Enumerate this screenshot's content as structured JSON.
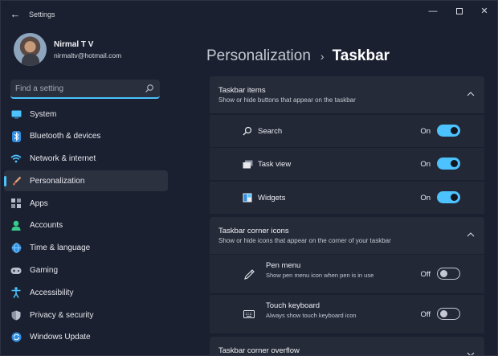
{
  "window": {
    "title": "Settings"
  },
  "user": {
    "name": "Nirmal T V",
    "email": "nirmaltv@hotmail.com"
  },
  "search": {
    "placeholder": "Find a setting"
  },
  "nav": {
    "items": [
      {
        "label": "System",
        "icon": "monitor-icon",
        "color": "#4cc2ff"
      },
      {
        "label": "Bluetooth & devices",
        "icon": "bluetooth-icon",
        "color": "#4cc2ff"
      },
      {
        "label": "Network & internet",
        "icon": "wifi-icon",
        "color": "#4cc2ff"
      },
      {
        "label": "Personalization",
        "icon": "brush-icon",
        "color": "#e8a87c"
      },
      {
        "label": "Apps",
        "icon": "apps-icon",
        "color": "#b9bfcc"
      },
      {
        "label": "Accounts",
        "icon": "person-icon",
        "color": "#38c98c"
      },
      {
        "label": "Time & language",
        "icon": "globe-clock-icon",
        "color": "#4cc2ff"
      },
      {
        "label": "Gaming",
        "icon": "gamepad-icon",
        "color": "#b9bfcc"
      },
      {
        "label": "Accessibility",
        "icon": "accessibility-icon",
        "color": "#4cc2ff"
      },
      {
        "label": "Privacy & security",
        "icon": "shield-icon",
        "color": "#b9bfcc"
      },
      {
        "label": "Windows Update",
        "icon": "update-icon",
        "color": "#4cc2ff"
      }
    ],
    "active_index": 3
  },
  "breadcrumb": {
    "parent": "Personalization",
    "separator": "›",
    "current": "Taskbar"
  },
  "groups": {
    "taskbar_items": {
      "title": "Taskbar items",
      "subtitle": "Show or hide buttons that appear on the taskbar",
      "rows": [
        {
          "label": "Search",
          "state": "On",
          "icon": "search-icon"
        },
        {
          "label": "Task view",
          "state": "On",
          "icon": "task-view-icon"
        },
        {
          "label": "Widgets",
          "state": "On",
          "icon": "widgets-icon"
        }
      ]
    },
    "corner_icons": {
      "title": "Taskbar corner icons",
      "subtitle": "Show or hide icons that appear on the corner of your taskbar",
      "rows": [
        {
          "label": "Pen menu",
          "description": "Show pen menu icon when pen is in use",
          "state": "Off",
          "icon": "pen-icon"
        },
        {
          "label": "Touch keyboard",
          "description": "Always show touch keyboard icon",
          "state": "Off",
          "icon": "keyboard-icon"
        }
      ]
    },
    "corner_overflow": {
      "title": "Taskbar corner overflow"
    }
  },
  "colors": {
    "accent": "#4cc2ff",
    "background": "#1b2030",
    "card": "#232837"
  }
}
